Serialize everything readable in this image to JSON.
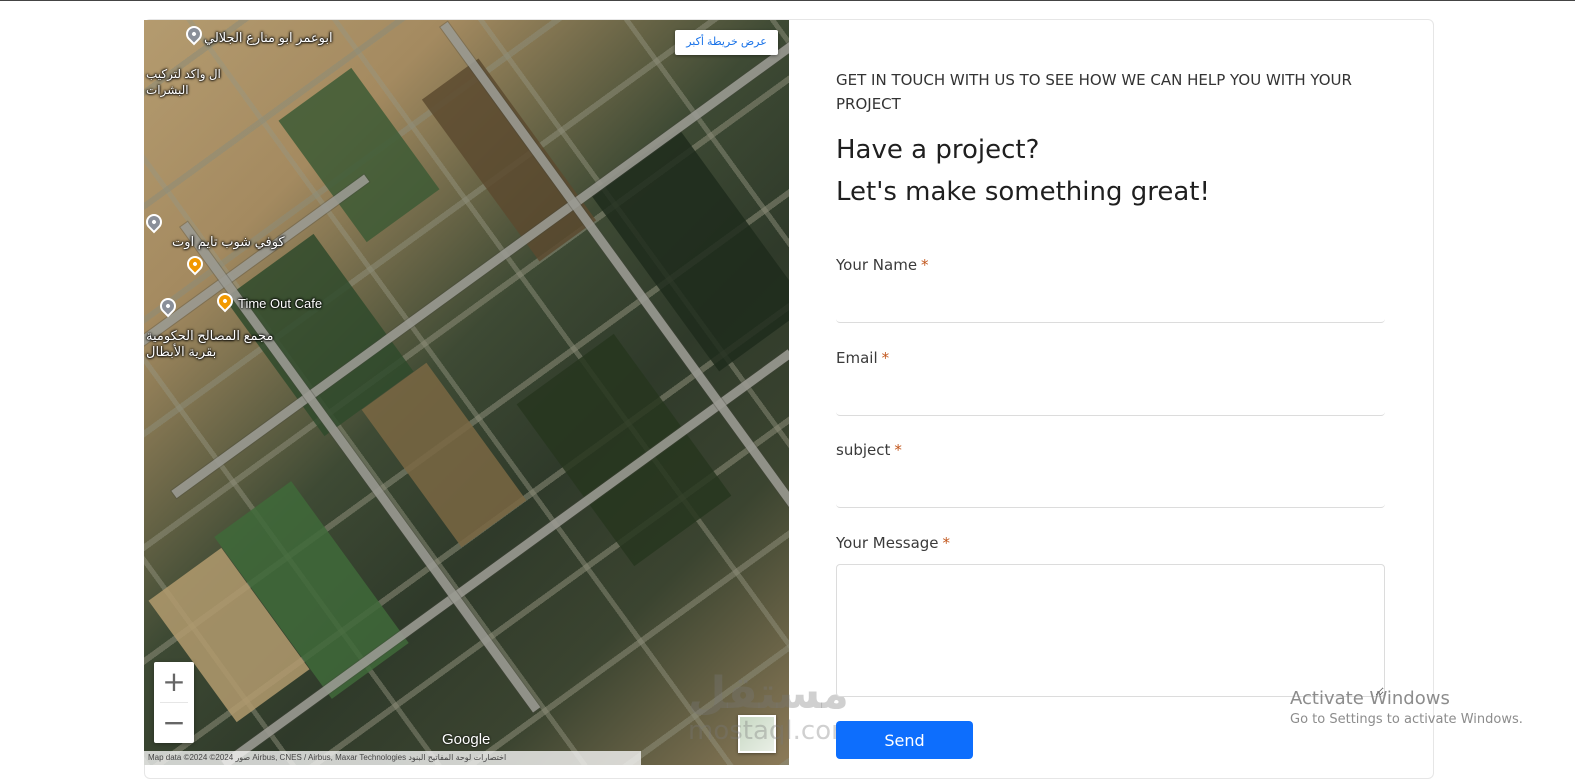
{
  "map": {
    "larger_map_label": "عرض خريطة أكبر",
    "places": [
      {
        "label": "ابوعمر ابو منارع الجلالي",
        "pin": "grey"
      },
      {
        "label": "ال واكد لتركيب البشرات",
        "pin": "none"
      },
      {
        "label": "كوفي شوب تايم اوت",
        "pin": "grey"
      },
      {
        "label": "Time Out Cafe",
        "pin": "orange"
      },
      {
        "label": "مجمع المصالح الحكومية بقرية الأبطال",
        "pin": "grey"
      }
    ],
    "zoom_in_label": "+",
    "zoom_out_label": "−",
    "logo": "Google",
    "attribution": "Map data ©2024 ©2024 صور Airbus, CNES / Airbus, Maxar Technologies   اختصارات لوحة المفاتيح   البنود"
  },
  "watermark": {
    "arabic": "مستقل",
    "latin": "mostaql.com"
  },
  "contact": {
    "kicker": "GET IN TOUCH WITH US TO SEE HOW WE CAN HELP YOU WITH YOUR PROJECT",
    "headline_line1": "Have a project?",
    "headline_line2": "Let's make something great!",
    "required_mark": "*",
    "fields": {
      "name_label": "Your Name",
      "email_label": "Email",
      "subject_label": "subject",
      "message_label": "Your Message"
    },
    "send_label": "Send"
  },
  "os_notice": {
    "title": "Activate Windows",
    "subtitle": "Go to Settings to activate Windows."
  },
  "colors": {
    "accent": "#0d6efd",
    "required": "#c2571d"
  }
}
